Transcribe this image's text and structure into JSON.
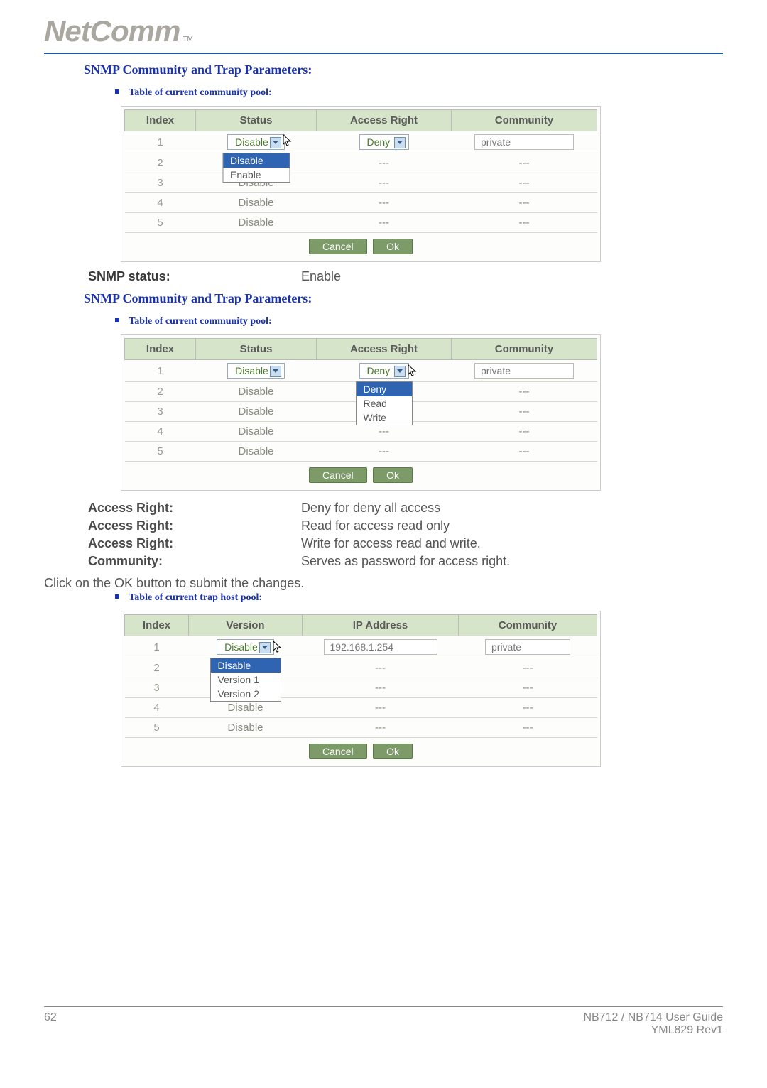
{
  "brand": {
    "logo": "NetComm",
    "tm": "TM"
  },
  "headings": {
    "snmp_params": "SNMP Community and Trap Parameters:",
    "community_pool": "Table of current community pool:",
    "trap_pool": "Table of current trap host pool:"
  },
  "buttons": {
    "cancel": "Cancel",
    "ok": "Ok"
  },
  "table1": {
    "headers": [
      "Index",
      "Status",
      "Access Right",
      "Community"
    ],
    "rows": [
      {
        "index": "1",
        "status_select": "Disable",
        "access_select": "Deny",
        "community_input": "private",
        "status_open": true
      },
      {
        "index": "2",
        "status": "Disable",
        "access": "---",
        "community": "---"
      },
      {
        "index": "3",
        "status": "Disable",
        "access": "---",
        "community": "---"
      },
      {
        "index": "4",
        "status": "Disable",
        "access": "---",
        "community": "---"
      },
      {
        "index": "5",
        "status": "Disable",
        "access": "---",
        "community": "---"
      }
    ],
    "status_options": [
      "Disable",
      "Enable"
    ]
  },
  "kv_snmp_status": {
    "label": "SNMP status:",
    "value": "Enable"
  },
  "table2": {
    "headers": [
      "Index",
      "Status",
      "Access Right",
      "Community"
    ],
    "rows": [
      {
        "index": "1",
        "status_select": "Disable",
        "access_select": "Deny",
        "community_input": "private",
        "access_open": true
      },
      {
        "index": "2",
        "status": "Disable",
        "access": "",
        "community": "---"
      },
      {
        "index": "3",
        "status": "Disable",
        "access": "",
        "community": "---"
      },
      {
        "index": "4",
        "status": "Disable",
        "access": "---",
        "community": "---"
      },
      {
        "index": "5",
        "status": "Disable",
        "access": "---",
        "community": "---"
      }
    ],
    "access_options": [
      "Deny",
      "Read",
      "Write"
    ]
  },
  "descriptions": [
    {
      "label": "Access Right:",
      "value": "Deny for deny all access"
    },
    {
      "label": "Access Right:",
      "value": "Read for access read only"
    },
    {
      "label": "Access Right:",
      "value": "Write for access read and write."
    },
    {
      "label": "Community:",
      "value": "Serves as password for access right."
    }
  ],
  "note_ok": "Click on the OK button to submit the changes.",
  "table3": {
    "headers": [
      "Index",
      "Version",
      "IP Address",
      "Community"
    ],
    "rows": [
      {
        "index": "1",
        "version_select": "Disable",
        "ip_input": "192.168.1.254",
        "community_input": "private",
        "version_open": true
      },
      {
        "index": "2",
        "version": "",
        "ip": "---",
        "community": "---"
      },
      {
        "index": "3",
        "version": "",
        "ip": "---",
        "community": "---"
      },
      {
        "index": "4",
        "version": "Disable",
        "ip": "---",
        "community": "---"
      },
      {
        "index": "5",
        "version": "Disable",
        "ip": "---",
        "community": "---"
      }
    ],
    "version_options": [
      "Disable",
      "Version 1",
      "Version 2"
    ]
  },
  "footer": {
    "page": "62",
    "guide": "NB712 / NB714 User Guide",
    "rev": "YML829 Rev1"
  }
}
